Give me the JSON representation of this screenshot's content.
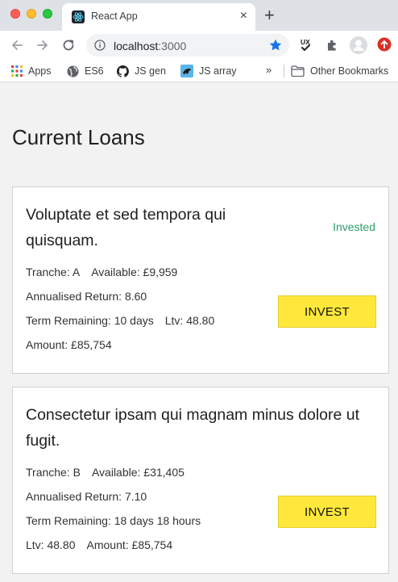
{
  "browser": {
    "tab_title": "React App",
    "tab_close": "×",
    "new_tab": "+",
    "url_host": "localhost",
    "url_port": ":3000",
    "bookmarks": [
      {
        "label": "Apps",
        "icon": "apps-grid-icon"
      },
      {
        "label": "ES6",
        "icon": "globe-icon"
      },
      {
        "label": "JS gen",
        "icon": "github-icon"
      },
      {
        "label": "JS array",
        "icon": "bookmark-favicon-icon"
      }
    ],
    "bookmarks_more": "»",
    "other_bookmarks": "Other Bookmarks"
  },
  "page": {
    "title": "Current Loans"
  },
  "loans": [
    {
      "title": "Voluptate et sed tempora qui quisquam.",
      "status": "Invested",
      "tranche": "Tranche: A",
      "available": "Available: £9,959",
      "annualised_return": "Annualised Return: 8.60",
      "term_remaining": "Term Remaining: 10 days",
      "ltv": "Ltv: 48.80",
      "amount": "Amount: £85,754",
      "button": "INVEST"
    },
    {
      "title": "Consectetur ipsam qui magnam minus dolore ut fugit.",
      "tranche": "Tranche: B",
      "available": "Available: £31,405",
      "annualised_return": "Annualised Return: 7.10",
      "term_remaining": "Term Remaining: 18 days 18 hours",
      "ltv": "Ltv: 48.80",
      "amount": "Amount: £85,754",
      "button": "INVEST"
    }
  ],
  "colors": {
    "accent_button": "#ffe83b",
    "status_invested": "#2e9e68",
    "star": "#1a73e8"
  }
}
